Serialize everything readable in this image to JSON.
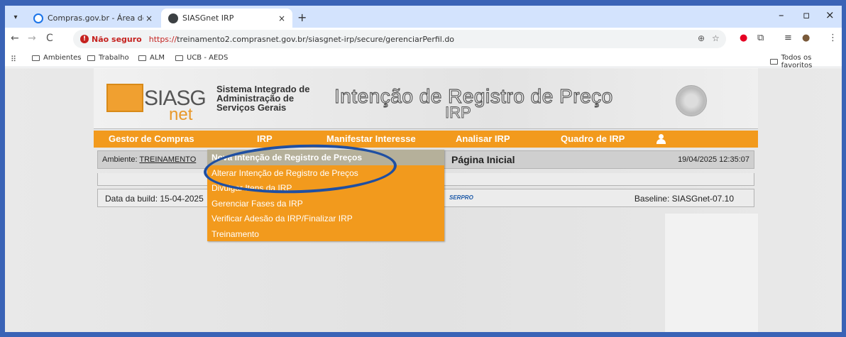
{
  "browser": {
    "tabs": [
      {
        "label": "Compras.gov.br - Área de Trab…",
        "close": "×"
      },
      {
        "label": "SIASGnet IRP",
        "close": "×"
      }
    ],
    "new_tab": "+",
    "window": {
      "minimize": "–",
      "maximize": "▫",
      "close": "×"
    },
    "nav": {
      "back": "←",
      "forward": "→",
      "reload": "C"
    },
    "address": {
      "security_label": "Não seguro",
      "scheme": "https://",
      "rest": "treinamento2.comprasnet.gov.br/siasgnet-irp/secure/gerenciarPerfil.do"
    },
    "bookmarks": [
      "Ambientes",
      "Trabalho",
      "ALM",
      "UCB - AEDS"
    ],
    "all_bookmarks": "Todos os favoritos"
  },
  "header": {
    "logo_main": "SIASG",
    "logo_sub": "net",
    "system_lines": [
      "Sistema Integrado de",
      "Administração de",
      "Serviços Gerais"
    ],
    "title": "Intenção de Registro de Preço",
    "subtitle": "IRP"
  },
  "menu": {
    "items": [
      "Gestor de Compras",
      "IRP",
      "Manifestar Interesse",
      "Analisar IRP",
      "Quadro de IRP"
    ],
    "dropdown": [
      "Nova Intenção de Registro de Preços",
      "Alterar Intenção de Registro de Preços",
      "Divulgar Itens da IRP",
      "Gerenciar Fases da IRP",
      "Verificar Adesão da IRP/Finalizar IRP",
      "Treinamento"
    ]
  },
  "info": {
    "env_label": "Ambiente:",
    "env_value": "TREINAMENTO",
    "page_title": "Página Inicial",
    "datetime": "19/04/2025 12:35:07",
    "build_date": "Data da build: 15-04-2025",
    "serpro": "SERPRO",
    "baseline": "Baseline: SIASGnet-07.10"
  }
}
